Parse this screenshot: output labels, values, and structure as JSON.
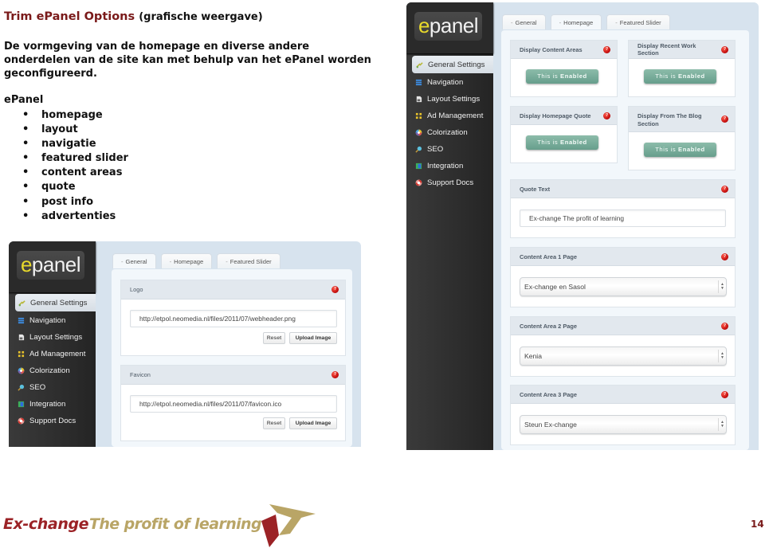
{
  "document": {
    "title": "Trim ePanel Options",
    "title_suffix": "(grafische weergave)",
    "intro": "De vormgeving van de homepage en diverse andere onderdelen van de site kan met behulp van het ePanel worden geconfigureerd.",
    "list_heading": "ePanel",
    "bullet": "•",
    "list_items": [
      "homepage",
      "layout",
      "navigatie",
      "featured slider",
      "content areas",
      "quote",
      "post info",
      "advertenties"
    ]
  },
  "epanel": {
    "logo_first_letter": "e",
    "logo_rest": "panel",
    "sidebar_items": [
      {
        "label": "General Settings",
        "icon": "wrench-icon",
        "active": true
      },
      {
        "label": "Navigation",
        "icon": "list-icon",
        "active": false
      },
      {
        "label": "Layout Settings",
        "icon": "document-icon",
        "active": false
      },
      {
        "label": "Ad Management",
        "icon": "grid-icon",
        "active": false
      },
      {
        "label": "Colorization",
        "icon": "color-wheel-icon",
        "active": false
      },
      {
        "label": "SEO",
        "icon": "magnifier-icon",
        "active": false
      },
      {
        "label": "Integration",
        "icon": "integration-icon",
        "active": false
      },
      {
        "label": "Support Docs",
        "icon": "lifebuoy-icon",
        "active": false
      }
    ],
    "tabs": [
      "General",
      "Homepage",
      "Featured Slider"
    ],
    "tab_dash": "-",
    "help_glyph": "?"
  },
  "homepage_panel": {
    "active_tab": "Homepage",
    "enabled_prefix": "This is",
    "enabled_word": "Enabled",
    "toggles": [
      {
        "label": "Display Content Areas",
        "state": "Enabled"
      },
      {
        "label": "Display Recent Work Section",
        "state": "Enabled"
      },
      {
        "label": "Display Homepage Quote",
        "state": "Enabled"
      },
      {
        "label": "Display From The Blog Section",
        "state": "Enabled"
      }
    ],
    "quote": {
      "label": "Quote Text",
      "value": "Ex-change The profit of learning"
    },
    "content_areas": [
      {
        "label": "Content Area 1 Page",
        "value": "Ex-change en Sasol"
      },
      {
        "label": "Content Area 2 Page",
        "value": "Kenia"
      },
      {
        "label": "Content Area 3 Page",
        "value": "Steun Ex-change"
      }
    ],
    "select_arrow_up": "▲",
    "select_arrow_down": "▼"
  },
  "general_panel": {
    "active_tab": "General",
    "fields": [
      {
        "label": "Logo",
        "value": "http://etpol.neomedia.nl/files/2011/07/webheader.png",
        "reset_label": "Reset",
        "upload_label": "Upload Image"
      },
      {
        "label": "Favicon",
        "value": "http://etpol.neomedia.nl/files/2011/07/favicon.ico",
        "reset_label": "Reset",
        "upload_label": "Upload Image"
      }
    ]
  },
  "footer": {
    "brand_name": "Ex-change",
    "brand_tagline": "The profit of learning",
    "page_number": "14",
    "colors": {
      "brand_red": "#9b2226",
      "brand_gold": "#b9a566"
    }
  },
  "colors": {
    "title_red": "#7a1a1a",
    "enabled_green": "#79ad9a",
    "help_red": "#c20d0d",
    "sidebar_dark": "#2b2b2b",
    "logo_yellow": "#e8d92b"
  }
}
